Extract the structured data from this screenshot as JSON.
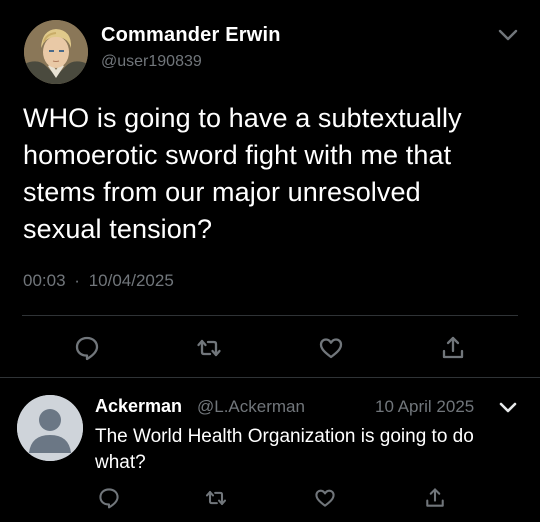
{
  "tweet": {
    "author": {
      "display_name": "Commander Erwin",
      "handle": "@user190839"
    },
    "text": "WHO is going to have a subtextually homoerotic sword fight with me that stems from our major unresolved sexual tension?",
    "time": "00:03",
    "separator": "·",
    "date": "10/04/2025",
    "actions": [
      "reply-icon",
      "retweet-icon",
      "like-icon",
      "share-icon"
    ]
  },
  "reply": {
    "author": {
      "display_name": "Ackerman",
      "handle": "@L.Ackerman"
    },
    "date": "10 April 2025",
    "text": "The World Health Organization is going to do what?",
    "actions": [
      "reply-icon",
      "retweet-icon",
      "like-icon",
      "share-icon"
    ]
  },
  "colors": {
    "background": "#000000",
    "primary_text": "#ffffff",
    "secondary_text": "#71767b",
    "divider": "#2f3336",
    "icon": "#71767b"
  }
}
